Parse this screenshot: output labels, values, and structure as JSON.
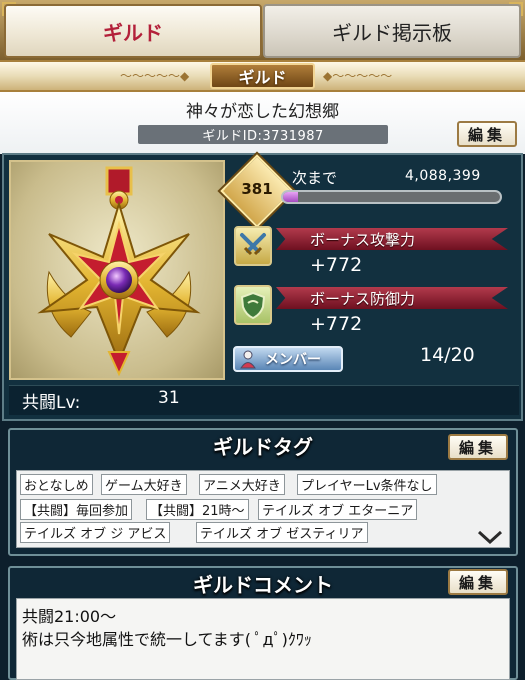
{
  "tabs": [
    {
      "label": "ギルド",
      "active": true
    },
    {
      "label": "ギルド掲示板",
      "active": false
    }
  ],
  "header": {
    "title": "ギルド"
  },
  "guild": {
    "name": "神々が恋した幻想郷",
    "id_text": "ギルドID:3731987",
    "edit_label": "編集"
  },
  "status": {
    "level": "381",
    "next_label": "次まで",
    "exp_to_next": "4,088,399",
    "exp_progress": 0.07,
    "attack_bonus_label": "ボーナス攻撃力",
    "attack_bonus_value": "+772",
    "defense_bonus_label": "ボーナス防御力",
    "defense_bonus_value": "+772",
    "member_label": "メンバー",
    "member_count": "14/20",
    "coop_label": "共闘Lv:",
    "coop_value": "31"
  },
  "tags_section": {
    "title": "ギルドタグ",
    "edit_label": "編集",
    "tags": [
      "おとなしめ",
      "ゲーム大好き",
      "アニメ大好き",
      "プレイヤーLv条件なし",
      "【共闘】毎回参加",
      "【共闘】21時～",
      "テイルズ オブ エターニア",
      "テイルズ オブ ジ アビス",
      "テイルズ オブ ゼスティリア"
    ],
    "more_icon": "chevron-down-icon"
  },
  "comment_section": {
    "title": "ギルドコメント",
    "edit_label": "編集",
    "lines": [
      "共闘21:00～",
      "術は只今地属性で統一してます( ﾟдﾟ)ｸﾜｯ"
    ]
  },
  "colors": {
    "active_tab_text": "#b3203a",
    "panel_bg": "#12303f",
    "exp_fill": "#c066d8",
    "ribbon": "#8a1a2c"
  }
}
